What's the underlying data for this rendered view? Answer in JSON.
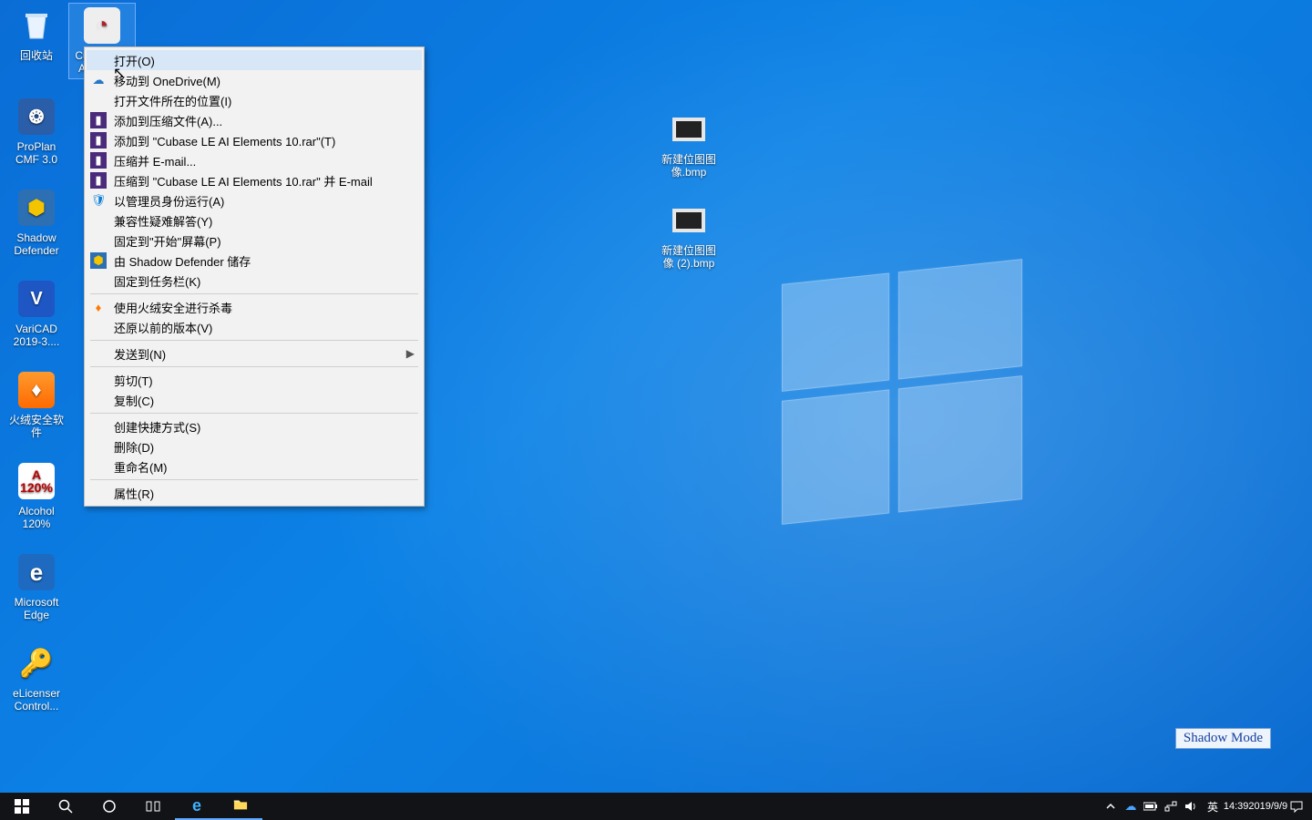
{
  "desktop_icons": {
    "recycle": {
      "label": "回收站"
    },
    "cubase": {
      "label": "Cubase LE AI Elem..."
    },
    "proplan": {
      "label": "ProPlan CMF 3.0"
    },
    "shadowdef": {
      "label": "Shadow Defender"
    },
    "varicad": {
      "label": "VariCAD 2019-3...."
    },
    "huorong": {
      "label": "火绒安全软件"
    },
    "alcohol": {
      "label": "Alcohol 120%"
    },
    "edge": {
      "label": "Microsoft Edge"
    },
    "elicenser": {
      "label": "eLicenser Control..."
    },
    "bmp1": {
      "label": "新建位图图像.bmp"
    },
    "bmp2": {
      "label": "新建位图图像 (2).bmp"
    }
  },
  "context_menu": {
    "open": "打开(O)",
    "move_onedrive": "移动到 OneDrive(M)",
    "open_location": "打开文件所在的位置(I)",
    "rar_add": "添加到压缩文件(A)...",
    "rar_add_named": "添加到 \"Cubase LE AI Elements 10.rar\"(T)",
    "rar_email": "压缩并 E-mail...",
    "rar_email_named": "压缩到 \"Cubase LE AI Elements 10.rar\" 并 E-mail",
    "run_admin": "以管理员身份运行(A)",
    "compat": "兼容性疑难解答(Y)",
    "pin_start": "固定到\"开始\"屏幕(P)",
    "shadow_save": "由 Shadow Defender 储存",
    "pin_taskbar": "固定到任务栏(K)",
    "huorong_scan": "使用火绒安全进行杀毒",
    "restore_prev": "还原以前的版本(V)",
    "send_to": "发送到(N)",
    "cut": "剪切(T)",
    "copy": "复制(C)",
    "shortcut": "创建快捷方式(S)",
    "delete": "删除(D)",
    "rename": "重命名(M)",
    "properties": "属性(R)"
  },
  "watermark": "Shadow Mode",
  "tray": {
    "ime": "英",
    "time": "14:39",
    "date": "2019/9/9"
  }
}
